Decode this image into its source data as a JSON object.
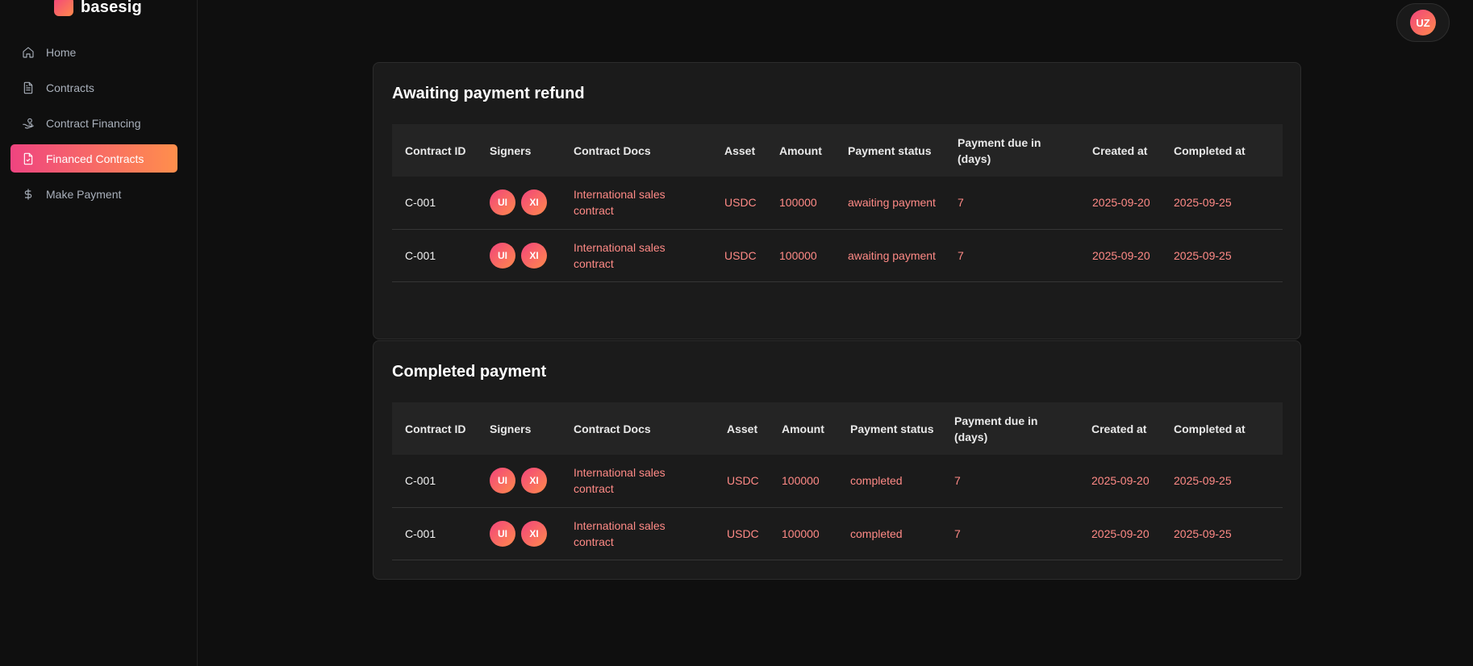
{
  "brand": {
    "name": "basesig"
  },
  "nav": [
    {
      "label": "Home",
      "icon": "home-icon",
      "active": false
    },
    {
      "label": "Contracts",
      "icon": "document-icon",
      "active": false
    },
    {
      "label": "Contract Financing",
      "icon": "hand-coin-icon",
      "active": false
    },
    {
      "label": "Financed Contracts",
      "icon": "document-check-icon",
      "active": true
    },
    {
      "label": "Make Payment",
      "icon": "dollar-icon",
      "active": false
    }
  ],
  "user": {
    "initials": "UZ"
  },
  "colors": {
    "accent_start": "#f2447c",
    "accent_end": "#ff8a4c",
    "value_text": "#ff8a86"
  },
  "awaiting": {
    "title": "Awaiting payment refund",
    "headers": [
      "Contract ID",
      "Signers",
      "Contract Docs",
      "Asset",
      "Amount",
      "Payment status",
      "Payment due in (days)",
      "Created at",
      "Completed at"
    ],
    "rows": [
      {
        "id": "C-001",
        "signers": [
          "UI",
          "XI"
        ],
        "doc": "International sales contract",
        "asset": "USDC",
        "amount": "100000",
        "status": "awaiting payment",
        "due": "7",
        "created": "2025-09-20",
        "completed": "2025-09-25"
      },
      {
        "id": "C-001",
        "signers": [
          "UI",
          "XI"
        ],
        "doc": "International sales contract",
        "asset": "USDC",
        "amount": "100000",
        "status": "awaiting payment",
        "due": "7",
        "created": "2025-09-20",
        "completed": "2025-09-25"
      }
    ]
  },
  "completed": {
    "title": "Completed payment",
    "headers": [
      "Contract ID",
      "Signers",
      "Contract Docs",
      "Asset",
      "Amount",
      "Payment status",
      "Payment due in (days)",
      "Created at",
      "Completed at"
    ],
    "rows": [
      {
        "id": "C-001",
        "signers": [
          "UI",
          "XI"
        ],
        "doc": "International sales contract",
        "asset": "USDC",
        "amount": "100000",
        "status": "completed",
        "due": "7",
        "created": "2025-09-20",
        "completed": "2025-09-25"
      },
      {
        "id": "C-001",
        "signers": [
          "UI",
          "XI"
        ],
        "doc": "International sales contract",
        "asset": "USDC",
        "amount": "100000",
        "status": "completed",
        "due": "7",
        "created": "2025-09-20",
        "completed": "2025-09-25"
      }
    ]
  }
}
